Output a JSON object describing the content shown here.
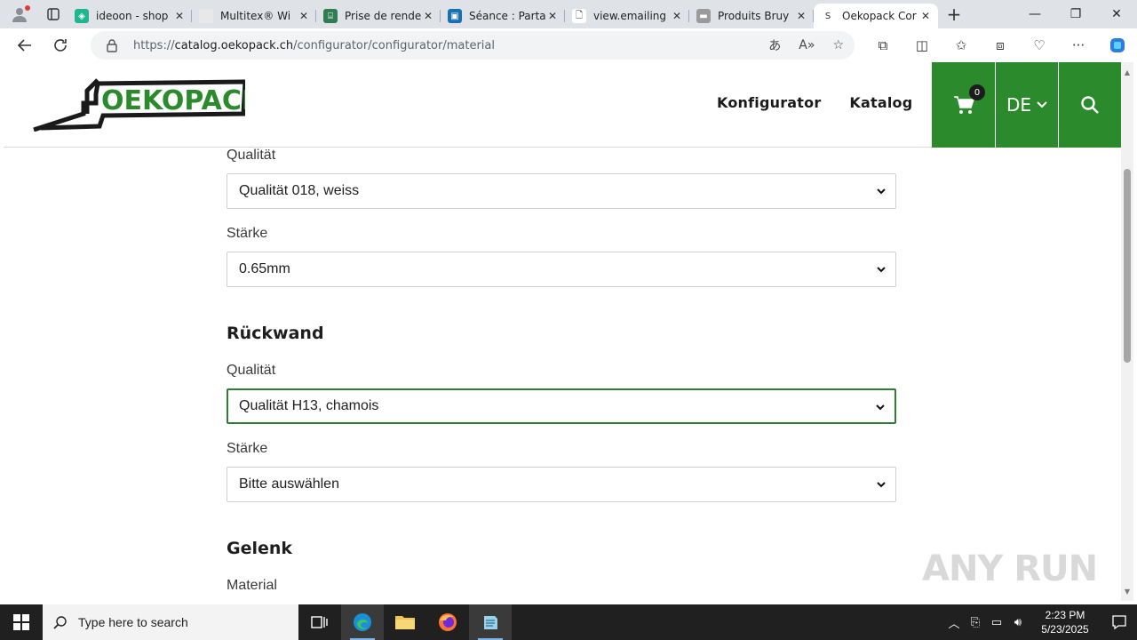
{
  "browser": {
    "tabs": [
      {
        "title": "ideoon - shop",
        "fav_color": "#1fb58f",
        "fav_glyph": "◈"
      },
      {
        "title": "Multitex® Wi",
        "fav_color": "#e8e8e8",
        "fav_glyph": ""
      },
      {
        "title": "Prise de rende",
        "fav_color": "#2f7d53",
        "fav_glyph": "⌸"
      },
      {
        "title": "Séance : Parta",
        "fav_color": "#1a6fb0",
        "fav_glyph": "▣"
      },
      {
        "title": "view.emailing",
        "fav_color": "#ffffff",
        "fav_glyph": "🗋"
      },
      {
        "title": "Produits Bruy",
        "fav_color": "#9a9a9a",
        "fav_glyph": "▬"
      },
      {
        "title": "Oekopack Cor",
        "fav_color": "#ffffff",
        "fav_glyph": "S",
        "active": true
      }
    ],
    "url_prefix": "https://",
    "url_host": "catalog.oekopack.ch",
    "url_path": "/configurator/configurator/material"
  },
  "header": {
    "logo_text": "OEKOPACK",
    "nav": [
      "Konfigurator",
      "Katalog"
    ],
    "cart_count": "0",
    "language": "DE",
    "brand_color": "#2b8a2c"
  },
  "form": {
    "top_quality_label": "Qualität",
    "top_quality_value": "Qualität 018, weiss",
    "top_thickness_label": "Stärke",
    "top_thickness_value": "0.65mm",
    "back_section": "Rückwand",
    "back_quality_label": "Qualität",
    "back_quality_value": "Qualität H13, chamois",
    "back_thickness_label": "Stärke",
    "back_thickness_value": "Bitte auswählen",
    "joint_section": "Gelenk",
    "joint_material_label": "Material"
  },
  "watermark": "ANY RUN",
  "taskbar": {
    "search_placeholder": "Type here to search",
    "time": "2:23 PM",
    "date": "5/23/2025"
  }
}
